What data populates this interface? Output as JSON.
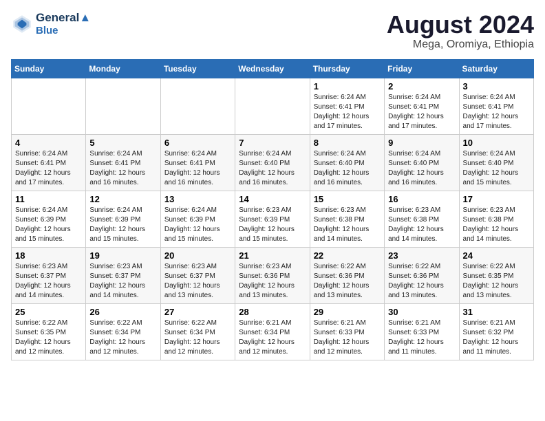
{
  "header": {
    "logo_line1": "General",
    "logo_line2": "Blue",
    "title": "August 2024",
    "subtitle": "Mega, Oromiya, Ethiopia"
  },
  "weekdays": [
    "Sunday",
    "Monday",
    "Tuesday",
    "Wednesday",
    "Thursday",
    "Friday",
    "Saturday"
  ],
  "weeks": [
    [
      {
        "day": "",
        "sunrise": "",
        "sunset": "",
        "daylight": ""
      },
      {
        "day": "",
        "sunrise": "",
        "sunset": "",
        "daylight": ""
      },
      {
        "day": "",
        "sunrise": "",
        "sunset": "",
        "daylight": ""
      },
      {
        "day": "",
        "sunrise": "",
        "sunset": "",
        "daylight": ""
      },
      {
        "day": "1",
        "sunrise": "Sunrise: 6:24 AM",
        "sunset": "Sunset: 6:41 PM",
        "daylight": "Daylight: 12 hours and 17 minutes."
      },
      {
        "day": "2",
        "sunrise": "Sunrise: 6:24 AM",
        "sunset": "Sunset: 6:41 PM",
        "daylight": "Daylight: 12 hours and 17 minutes."
      },
      {
        "day": "3",
        "sunrise": "Sunrise: 6:24 AM",
        "sunset": "Sunset: 6:41 PM",
        "daylight": "Daylight: 12 hours and 17 minutes."
      }
    ],
    [
      {
        "day": "4",
        "sunrise": "Sunrise: 6:24 AM",
        "sunset": "Sunset: 6:41 PM",
        "daylight": "Daylight: 12 hours and 17 minutes."
      },
      {
        "day": "5",
        "sunrise": "Sunrise: 6:24 AM",
        "sunset": "Sunset: 6:41 PM",
        "daylight": "Daylight: 12 hours and 16 minutes."
      },
      {
        "day": "6",
        "sunrise": "Sunrise: 6:24 AM",
        "sunset": "Sunset: 6:41 PM",
        "daylight": "Daylight: 12 hours and 16 minutes."
      },
      {
        "day": "7",
        "sunrise": "Sunrise: 6:24 AM",
        "sunset": "Sunset: 6:40 PM",
        "daylight": "Daylight: 12 hours and 16 minutes."
      },
      {
        "day": "8",
        "sunrise": "Sunrise: 6:24 AM",
        "sunset": "Sunset: 6:40 PM",
        "daylight": "Daylight: 12 hours and 16 minutes."
      },
      {
        "day": "9",
        "sunrise": "Sunrise: 6:24 AM",
        "sunset": "Sunset: 6:40 PM",
        "daylight": "Daylight: 12 hours and 16 minutes."
      },
      {
        "day": "10",
        "sunrise": "Sunrise: 6:24 AM",
        "sunset": "Sunset: 6:40 PM",
        "daylight": "Daylight: 12 hours and 15 minutes."
      }
    ],
    [
      {
        "day": "11",
        "sunrise": "Sunrise: 6:24 AM",
        "sunset": "Sunset: 6:39 PM",
        "daylight": "Daylight: 12 hours and 15 minutes."
      },
      {
        "day": "12",
        "sunrise": "Sunrise: 6:24 AM",
        "sunset": "Sunset: 6:39 PM",
        "daylight": "Daylight: 12 hours and 15 minutes."
      },
      {
        "day": "13",
        "sunrise": "Sunrise: 6:24 AM",
        "sunset": "Sunset: 6:39 PM",
        "daylight": "Daylight: 12 hours and 15 minutes."
      },
      {
        "day": "14",
        "sunrise": "Sunrise: 6:23 AM",
        "sunset": "Sunset: 6:39 PM",
        "daylight": "Daylight: 12 hours and 15 minutes."
      },
      {
        "day": "15",
        "sunrise": "Sunrise: 6:23 AM",
        "sunset": "Sunset: 6:38 PM",
        "daylight": "Daylight: 12 hours and 14 minutes."
      },
      {
        "day": "16",
        "sunrise": "Sunrise: 6:23 AM",
        "sunset": "Sunset: 6:38 PM",
        "daylight": "Daylight: 12 hours and 14 minutes."
      },
      {
        "day": "17",
        "sunrise": "Sunrise: 6:23 AM",
        "sunset": "Sunset: 6:38 PM",
        "daylight": "Daylight: 12 hours and 14 minutes."
      }
    ],
    [
      {
        "day": "18",
        "sunrise": "Sunrise: 6:23 AM",
        "sunset": "Sunset: 6:37 PM",
        "daylight": "Daylight: 12 hours and 14 minutes."
      },
      {
        "day": "19",
        "sunrise": "Sunrise: 6:23 AM",
        "sunset": "Sunset: 6:37 PM",
        "daylight": "Daylight: 12 hours and 14 minutes."
      },
      {
        "day": "20",
        "sunrise": "Sunrise: 6:23 AM",
        "sunset": "Sunset: 6:37 PM",
        "daylight": "Daylight: 12 hours and 13 minutes."
      },
      {
        "day": "21",
        "sunrise": "Sunrise: 6:23 AM",
        "sunset": "Sunset: 6:36 PM",
        "daylight": "Daylight: 12 hours and 13 minutes."
      },
      {
        "day": "22",
        "sunrise": "Sunrise: 6:22 AM",
        "sunset": "Sunset: 6:36 PM",
        "daylight": "Daylight: 12 hours and 13 minutes."
      },
      {
        "day": "23",
        "sunrise": "Sunrise: 6:22 AM",
        "sunset": "Sunset: 6:36 PM",
        "daylight": "Daylight: 12 hours and 13 minutes."
      },
      {
        "day": "24",
        "sunrise": "Sunrise: 6:22 AM",
        "sunset": "Sunset: 6:35 PM",
        "daylight": "Daylight: 12 hours and 13 minutes."
      }
    ],
    [
      {
        "day": "25",
        "sunrise": "Sunrise: 6:22 AM",
        "sunset": "Sunset: 6:35 PM",
        "daylight": "Daylight: 12 hours and 12 minutes."
      },
      {
        "day": "26",
        "sunrise": "Sunrise: 6:22 AM",
        "sunset": "Sunset: 6:34 PM",
        "daylight": "Daylight: 12 hours and 12 minutes."
      },
      {
        "day": "27",
        "sunrise": "Sunrise: 6:22 AM",
        "sunset": "Sunset: 6:34 PM",
        "daylight": "Daylight: 12 hours and 12 minutes."
      },
      {
        "day": "28",
        "sunrise": "Sunrise: 6:21 AM",
        "sunset": "Sunset: 6:34 PM",
        "daylight": "Daylight: 12 hours and 12 minutes."
      },
      {
        "day": "29",
        "sunrise": "Sunrise: 6:21 AM",
        "sunset": "Sunset: 6:33 PM",
        "daylight": "Daylight: 12 hours and 12 minutes."
      },
      {
        "day": "30",
        "sunrise": "Sunrise: 6:21 AM",
        "sunset": "Sunset: 6:33 PM",
        "daylight": "Daylight: 12 hours and 11 minutes."
      },
      {
        "day": "31",
        "sunrise": "Sunrise: 6:21 AM",
        "sunset": "Sunset: 6:32 PM",
        "daylight": "Daylight: 12 hours and 11 minutes."
      }
    ]
  ]
}
